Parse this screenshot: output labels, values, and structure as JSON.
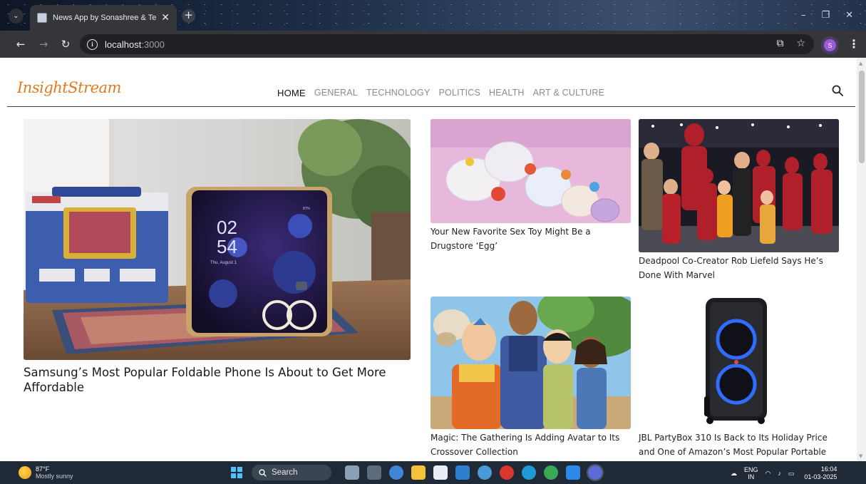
{
  "browser": {
    "tab_title": "News App by Sonashree & Team",
    "url_host": "localhost",
    "url_port": ":3000",
    "profile_initial": "S"
  },
  "site": {
    "logo": "InsightStream",
    "nav": [
      "HOME",
      "GENERAL",
      "TECHNOLOGY",
      "POLITICS",
      "HEALTH",
      "ART & CULTURE"
    ],
    "active_nav": "HOME"
  },
  "articles": {
    "main": {
      "title": "Samsung’s Most Popular Foldable Phone Is About to Get More Affordable",
      "clock_hour": "02",
      "clock_minute": "54",
      "date": "Thu, August 1",
      "battery": "87%"
    },
    "a1": {
      "title": "Your New Favorite Sex Toy Might Be a Drugstore ‘Egg’"
    },
    "a2": {
      "title": "Deadpool Co-Creator Rob Liefeld Says He’s Done With Marvel"
    },
    "a3": {
      "title": "Magic: The Gathering Is Adding Avatar to Its Crossover Collection"
    },
    "a4": {
      "title": "JBL PartyBox 310 Is Back to Its Holiday Price and One of Amazon’s Most Popular Portable"
    }
  },
  "taskbar": {
    "temperature": "87°F",
    "condition": "Mostly sunny",
    "search_label": "Search",
    "lang_top": "ENG",
    "lang_bottom": "IN",
    "time": "16:04",
    "date": "01-03-2025"
  },
  "colors": {
    "brand": "#e07a1f",
    "chrome_dark": "#35363a",
    "taskbar": "#1f2a36"
  }
}
